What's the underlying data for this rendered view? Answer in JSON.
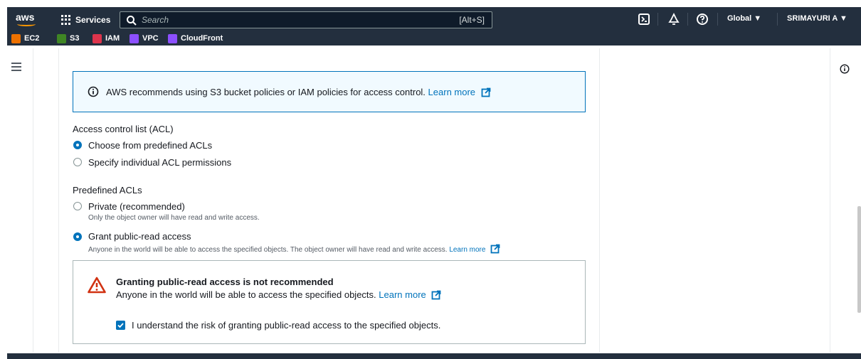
{
  "nav": {
    "logo": "aws",
    "services_label": "Services",
    "search_placeholder": "Search",
    "search_shortcut": "[Alt+S]",
    "region_label": "Global ▼",
    "user_label": "SRIMAYURI A ▼"
  },
  "favorites": [
    {
      "label": "EC2",
      "color": "#ed7100"
    },
    {
      "label": "S3",
      "color": "#3f8624"
    },
    {
      "label": "IAM",
      "color": "#dd344c"
    },
    {
      "label": "VPC",
      "color": "#8c4fff"
    },
    {
      "label": "CloudFront",
      "color": "#8c4fff"
    }
  ],
  "info_alert": {
    "text": "AWS recommends using S3 bucket policies or IAM policies for access control.",
    "link": "Learn more"
  },
  "acl": {
    "heading": "Access control list (ACL)",
    "options": [
      {
        "label": "Choose from predefined ACLs",
        "checked": true
      },
      {
        "label": "Specify individual ACL permissions",
        "checked": false
      }
    ]
  },
  "predefined": {
    "heading": "Predefined ACLs",
    "private_label": "Private (recommended)",
    "private_desc": "Only the object owner will have read and write access.",
    "public_label": "Grant public-read access",
    "public_desc": "Anyone in the world will be able to access the specified objects. The object owner will have read and write access.",
    "public_link": "Learn more"
  },
  "warning": {
    "title": "Granting public-read access is not recommended",
    "text": "Anyone in the world will be able to access the specified objects.",
    "link": "Learn more",
    "checkbox_label": "I understand the risk of granting public-read access to the specified objects.",
    "checkbox_checked": true
  },
  "colors": {
    "nav_bg": "#232f3e",
    "accent": "#0073bb",
    "warning": "#d13212",
    "info_bg": "#f1faff"
  }
}
